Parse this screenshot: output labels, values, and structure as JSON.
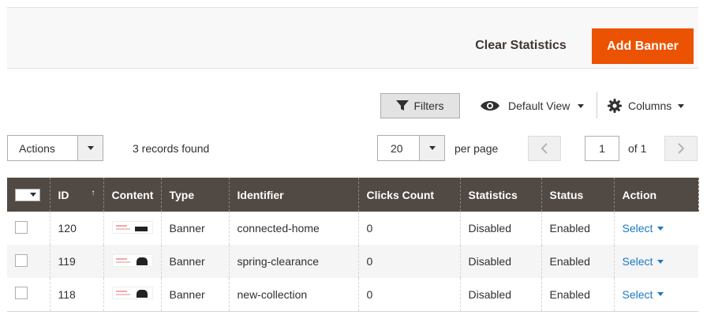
{
  "header": {
    "clear_label": "Clear Statistics",
    "add_label": "Add Banner"
  },
  "toolbar": {
    "filters_label": "Filters",
    "view_label": "Default View",
    "columns_label": "Columns"
  },
  "mass_actions": {
    "selected": "Actions"
  },
  "records_found": "3 records found",
  "pager": {
    "per_page_value": "20",
    "per_page_label": "per page",
    "current_page": "1",
    "of_pages": "of 1"
  },
  "grid": {
    "columns": [
      "ID",
      "Content",
      "Type",
      "Identifier",
      "Clicks Count",
      "Statistics",
      "Status",
      "Action"
    ],
    "rows": [
      {
        "id": "120",
        "type": "Banner",
        "identifier": "connected-home",
        "clicks": "0",
        "statistics": "Disabled",
        "status": "Enabled",
        "action": "Select"
      },
      {
        "id": "119",
        "type": "Banner",
        "identifier": "spring-clearance",
        "clicks": "0",
        "statistics": "Disabled",
        "status": "Enabled",
        "action": "Select"
      },
      {
        "id": "118",
        "type": "Banner",
        "identifier": "new-collection",
        "clicks": "0",
        "statistics": "Disabled",
        "status": "Enabled",
        "action": "Select"
      }
    ]
  },
  "colors": {
    "primary_button": "#eb5202",
    "grid_header": "#514943",
    "link": "#1979c3"
  },
  "icons": {
    "filter": "funnel-icon",
    "view": "eye-icon",
    "columns": "gear-icon"
  }
}
